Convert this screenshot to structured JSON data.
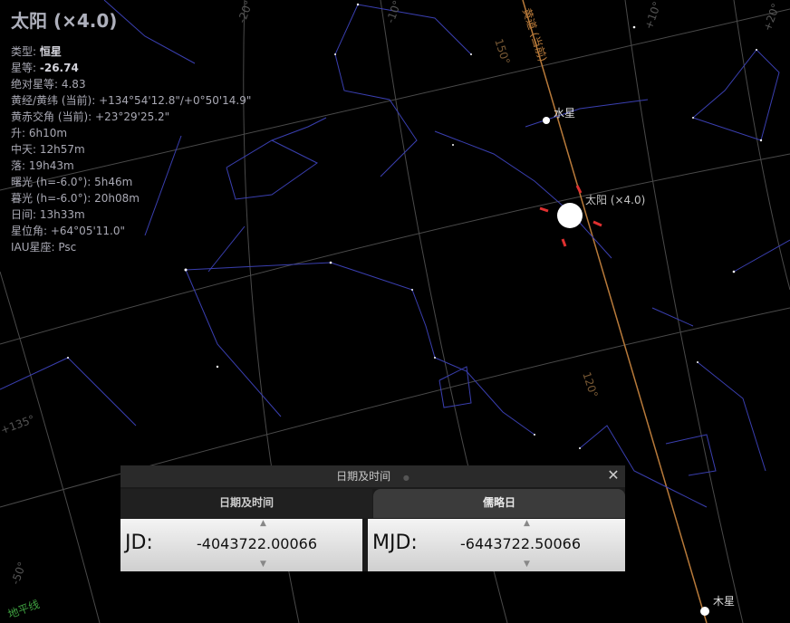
{
  "object_info": {
    "title": "太阳 (×4.0)",
    "rows": [
      {
        "label": "类型: ",
        "value": "恒星",
        "bold": true
      },
      {
        "label": "星等: ",
        "value": "-26.74",
        "bold": true
      },
      {
        "label": "绝对星等: ",
        "value": "4.83"
      },
      {
        "label": "黄经/黄纬 (当前): ",
        "value": "+134°54'12.8\"/+0°50'14.9\""
      },
      {
        "label": "黄赤交角 (当前): ",
        "value": "+23°29'25.2\""
      },
      {
        "label": "升: ",
        "value": "6h10m"
      },
      {
        "label": "中天: ",
        "value": "12h57m"
      },
      {
        "label": "落: ",
        "value": "19h43m"
      },
      {
        "label": "曙光 (h=-6.0°): ",
        "value": "5h46m"
      },
      {
        "label": "暮光 (h=-6.0°): ",
        "value": "20h08m"
      },
      {
        "label": "日间: ",
        "value": "13h33m"
      },
      {
        "label": "星位角: ",
        "value": "+64°05'11.0\""
      },
      {
        "label": "IAU星座: ",
        "value": "Psc"
      }
    ]
  },
  "sky_labels": {
    "mercury": "水星",
    "sun": "太阳 (×4.0)",
    "jupiter": "木星",
    "ecliptic": "黄道 (当前)",
    "deg_150": "150°",
    "deg_120": "120°",
    "deg_m20": "-20°",
    "deg_m10": "-10°",
    "deg_p10": "+10°",
    "deg_p20": "+20°",
    "deg_p135": "+135°",
    "deg_m50": "-50°",
    "horizon": "地平线"
  },
  "dialog": {
    "title": "日期及时间",
    "close": "✕",
    "tabs": [
      "日期及时间",
      "儒略日"
    ],
    "jd_label": "JD:",
    "jd_value": "-4043722.00066",
    "mjd_label": "MJD:",
    "mjd_value": "-6443722.50066",
    "up_arrow": "▲",
    "down_arrow": "▼"
  },
  "colors": {
    "background": "#000000",
    "constellation_lines": "#3a3fb0",
    "grid": "#4a4a4a",
    "ecliptic": "#b87a3a",
    "sun_marker": "#e03030"
  }
}
